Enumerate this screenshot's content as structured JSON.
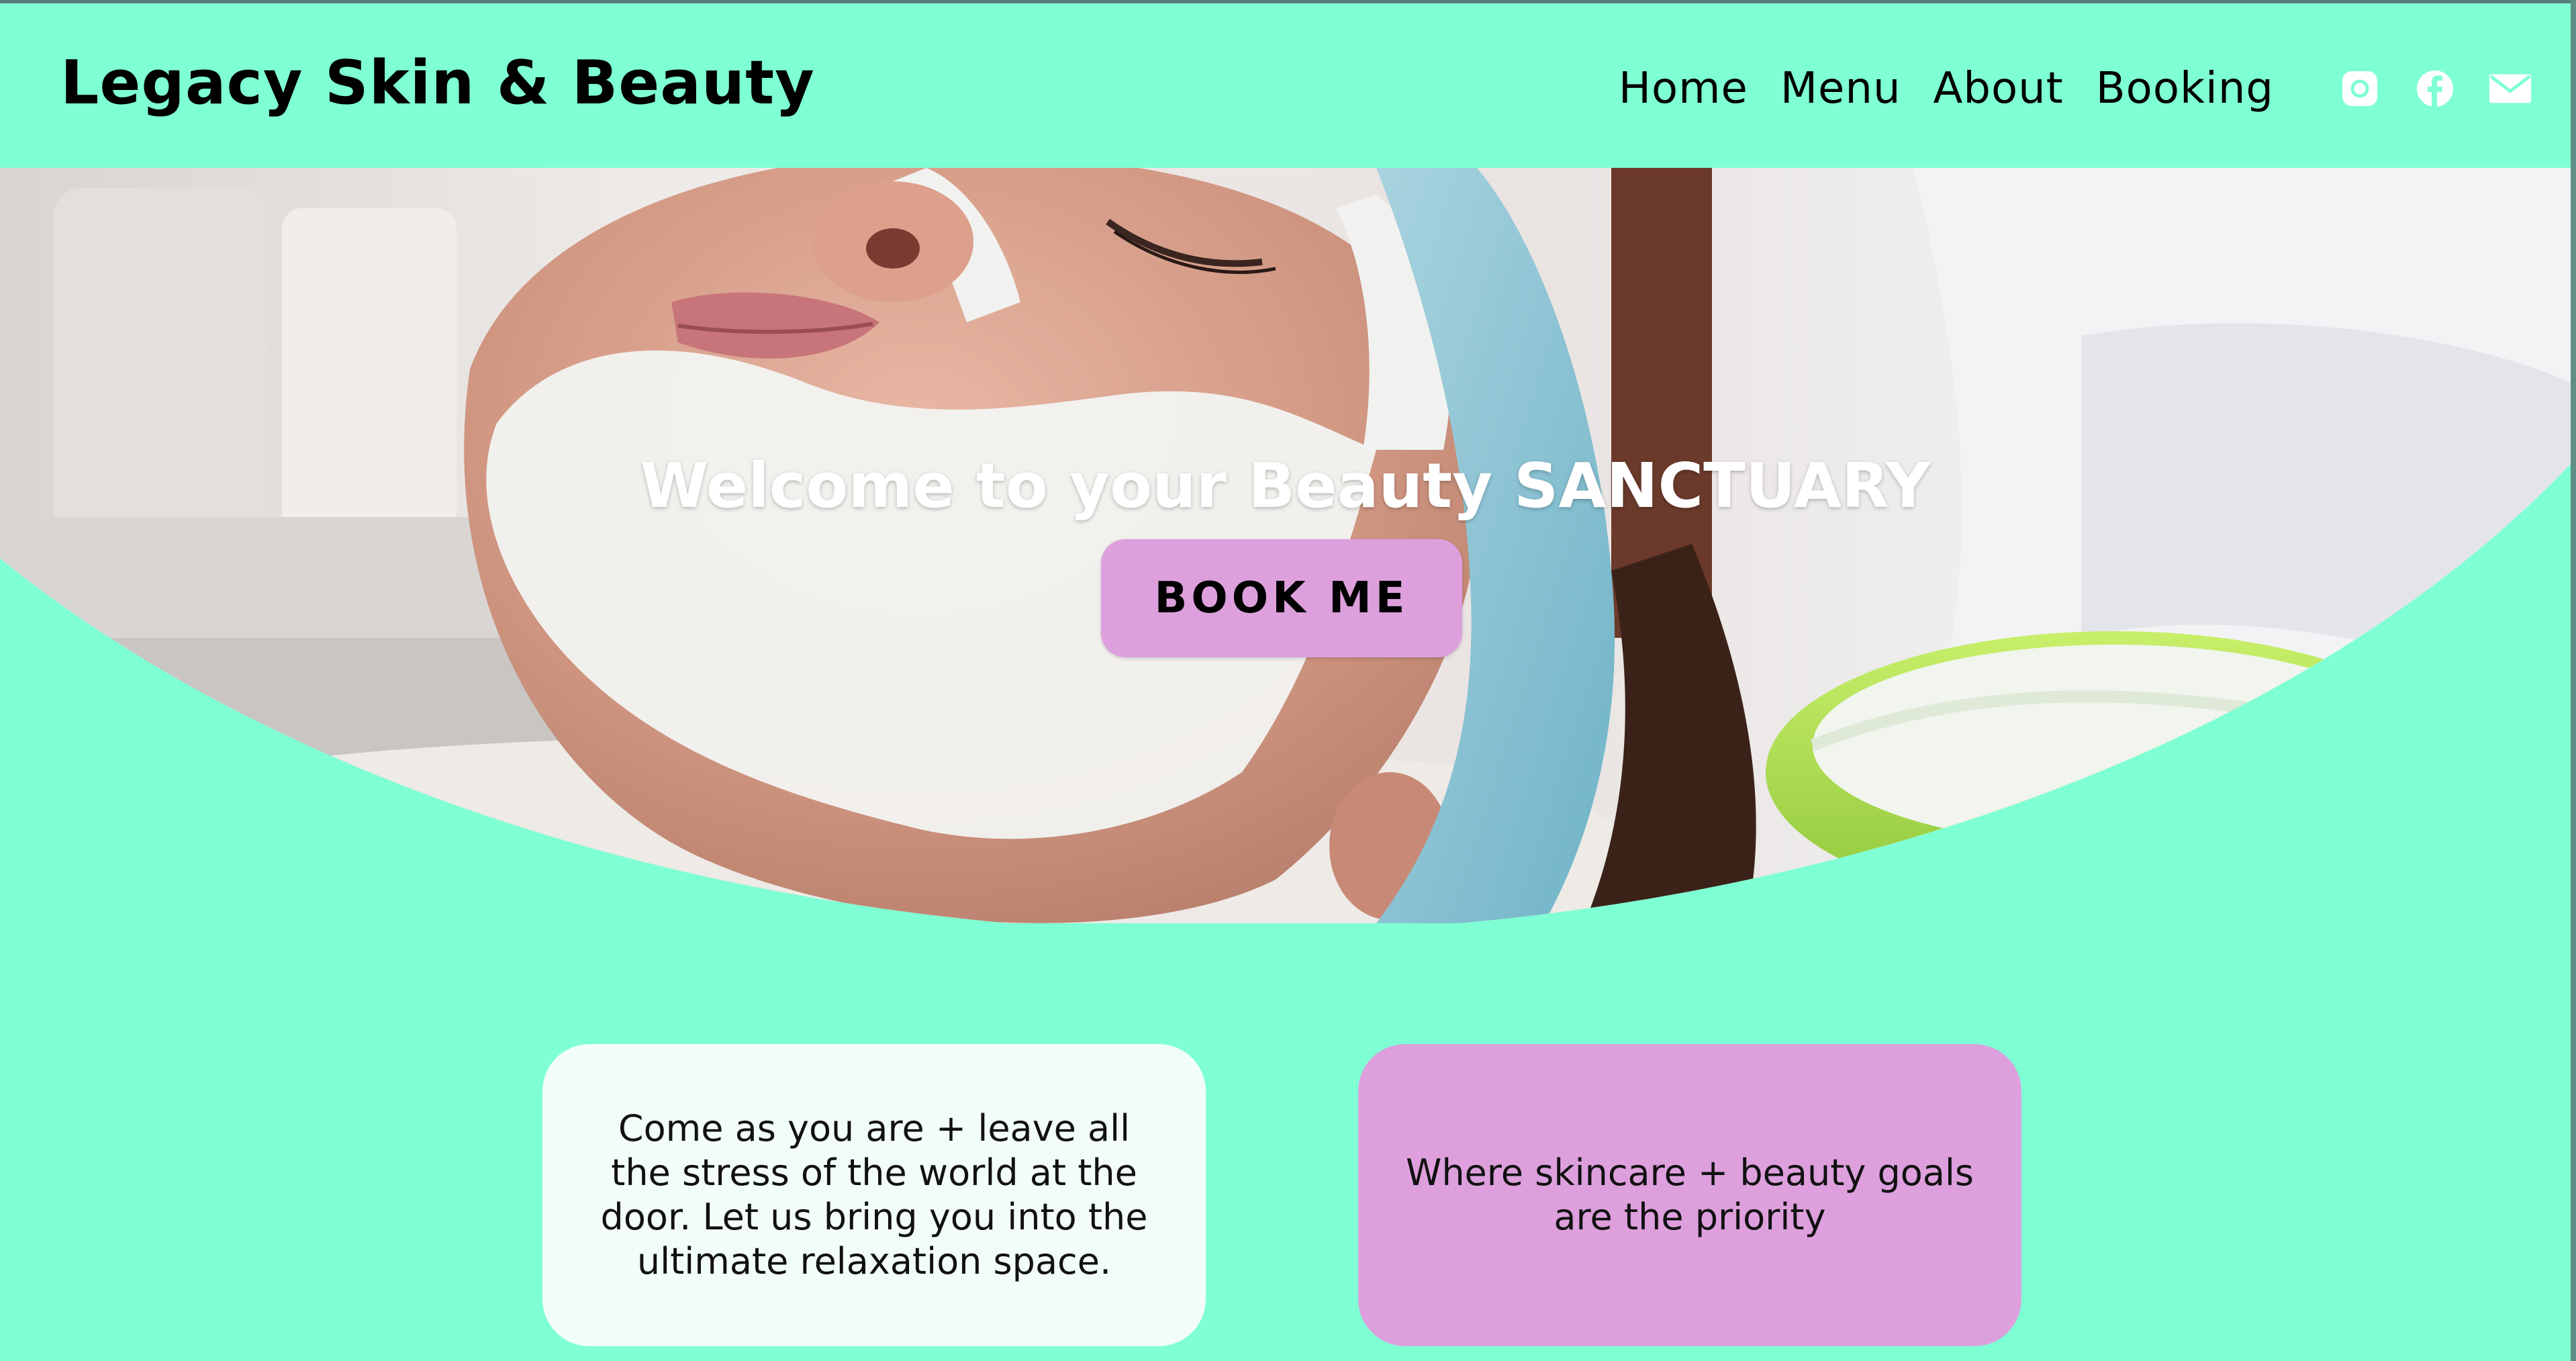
{
  "header": {
    "logo": "Legacy Skin & Beauty",
    "nav": [
      "Home",
      "Menu",
      "About",
      "Booking"
    ],
    "social_icons": [
      "instagram-icon",
      "facebook-icon",
      "email-icon"
    ]
  },
  "hero": {
    "title": "Welcome to your Beauty SANCTUARY",
    "button": "BOOK ME"
  },
  "cards": [
    "Come as you are + leave all the stress of the world at the door. Let us bring you into the ultimate relaxation space.",
    "Where skincare + beauty goals are the priority"
  ],
  "colors": {
    "background": "#7fffd4",
    "accent": "#dda0dd",
    "card_light": "#f2fdf9"
  }
}
